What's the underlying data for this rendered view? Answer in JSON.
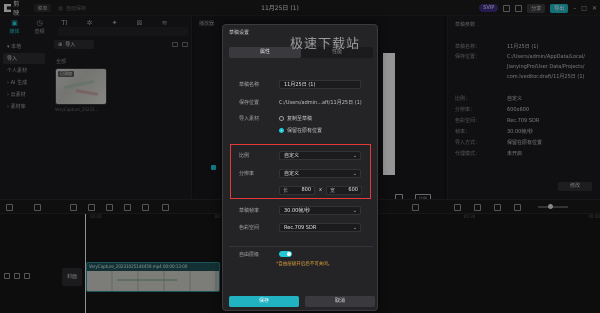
{
  "app": {
    "logo": "剪映",
    "menu_label": "菜单",
    "autosave": "自动保存",
    "title": "11月25日 (1)",
    "svip": "SVIP",
    "share": "分享",
    "export": "导出"
  },
  "left_tabs": [
    {
      "icon": "▣",
      "label": "媒体"
    },
    {
      "icon": "◷",
      "label": "音频"
    },
    {
      "icon": "TI",
      "label": "文本"
    },
    {
      "icon": "✲",
      "label": "贴纸"
    },
    {
      "icon": "✦",
      "label": "特效"
    },
    {
      "icon": "⊠",
      "label": "转场"
    },
    {
      "icon": "≋",
      "label": "滤镜"
    }
  ],
  "side_items": [
    {
      "label": "▾ 本地",
      "selected": false
    },
    {
      "label": "导入",
      "selected": true
    },
    {
      "label": "个人素材",
      "selected": false
    },
    {
      "label": "› AI 生成",
      "selected": false
    },
    {
      "label": "› 云素材",
      "selected": false
    },
    {
      "label": "› 素材库",
      "selected": false
    }
  ],
  "media": {
    "import_label": "导入",
    "all_label": "全部",
    "thumb_tag": "已添加",
    "thumb_name": "VeryCapture_20231..."
  },
  "player": {
    "title": "播放器",
    "ratio": "比例"
  },
  "right_panel": {
    "title": "草稿参数",
    "rows": [
      {
        "k": "草稿名称：",
        "v": "11月25日 (1)"
      },
      {
        "k": "保存位置：",
        "v": "C:/Users/admin/AppData/Local/"
      },
      {
        "k": "",
        "v": "JianyingPro/User Data/Projects/"
      },
      {
        "k": "",
        "v": "com.lveditor.draft/11月25日 (1)"
      },
      {
        "k": "比例：",
        "v": "自定义"
      },
      {
        "k": "分辨率：",
        "v": "600x600"
      },
      {
        "k": "色彩空间：",
        "v": "Rec.709 SDR"
      },
      {
        "k": "帧率：",
        "v": "30.00帧/秒"
      },
      {
        "k": "导入方式：",
        "v": "保留在原有位置"
      },
      {
        "k": "代理模式：",
        "v": "未开启"
      }
    ],
    "modify": "修改"
  },
  "timeline": {
    "ruler": [
      "00:00",
      "",
      "00:10",
      "",
      "00:20",
      "",
      "00:30",
      "",
      "00:40"
    ],
    "cover": "封面",
    "clip_label": "VeryCapture_20231025144459.mp4  00:00:13:00"
  },
  "dialog": {
    "title": "草稿设置",
    "tabs": [
      "属性",
      "性能"
    ],
    "name_label": "草稿名称",
    "name_value": "11月25日 (1)",
    "path_label": "保存位置",
    "path_value": "C:/Users/admin...aft/11月25日 (1)",
    "import_label": "导入素材",
    "import_opt1": "复制至草稿",
    "import_opt2": "保留在原有位置",
    "ratio_label": "比例",
    "ratio_value": "自定义",
    "res_label": "分辨率",
    "res_value": "自定义",
    "width_key": "长",
    "width_value": "800",
    "times": "x",
    "height_key": "宽",
    "height_value": "600",
    "fps_label": "草稿帧率",
    "fps_value": "30.00帧/秒",
    "color_label": "色彩空间",
    "color_value": "Rec.709 SDR",
    "layer_label": "自由层级",
    "hint": "*自由层级开启后不可关闭。",
    "save": "保存",
    "cancel": "取消"
  },
  "watermark": "极速下载站",
  "colors": {
    "accent": "#21c9d7",
    "highlight": "#e53a3a"
  }
}
